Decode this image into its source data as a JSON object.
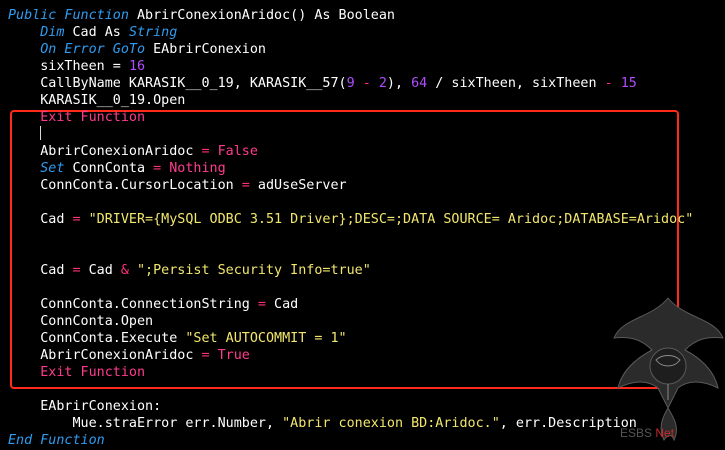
{
  "code": {
    "lines": [
      {
        "t": [
          [
            "kw",
            "Public Function"
          ],
          [
            "tx",
            " AbrirConexionAridoc() As Boolean"
          ]
        ]
      },
      {
        "t": [
          [
            "tx",
            "    "
          ],
          [
            "kw",
            "Dim"
          ],
          [
            "tx",
            " Cad As "
          ],
          [
            "kw",
            "String"
          ]
        ]
      },
      {
        "t": [
          [
            "tx",
            "    "
          ],
          [
            "kw",
            "On Error GoTo"
          ],
          [
            "tx",
            " EAbrirConexion"
          ]
        ]
      },
      {
        "t": [
          [
            "tx",
            "    sixTheen = "
          ],
          [
            "num",
            "16"
          ]
        ]
      },
      {
        "t": [
          [
            "tx",
            "    CallByName KARASIK__0_19, KARASIK__57("
          ],
          [
            "num",
            "9"
          ],
          [
            "op",
            " - "
          ],
          [
            "num",
            "2"
          ],
          [
            "tx",
            "), "
          ],
          [
            "num",
            "64"
          ],
          [
            "tx",
            " / sixTheen, sixTheen "
          ],
          [
            "op",
            "-"
          ],
          [
            "tx",
            " "
          ],
          [
            "num",
            "15"
          ]
        ]
      },
      {
        "t": [
          [
            "tx",
            "    KARASIK__0_19.Open"
          ]
        ]
      },
      {
        "t": [
          [
            "tx",
            "    "
          ],
          [
            "st",
            "Exit Function"
          ]
        ]
      },
      {
        "t": []
      },
      {
        "t": [
          [
            "tx",
            "    AbrirConexionAridoc "
          ],
          [
            "op",
            "="
          ],
          [
            "tx",
            " "
          ],
          [
            "st",
            "False"
          ]
        ]
      },
      {
        "t": [
          [
            "tx",
            "    "
          ],
          [
            "kw",
            "Set"
          ],
          [
            "tx",
            " ConnConta "
          ],
          [
            "op",
            "="
          ],
          [
            "tx",
            " "
          ],
          [
            "st",
            "Nothing"
          ]
        ]
      },
      {
        "t": [
          [
            "tx",
            "    ConnConta.CursorLocation "
          ],
          [
            "op",
            "="
          ],
          [
            "tx",
            " adUseServer"
          ]
        ]
      },
      {
        "t": []
      },
      {
        "t": [
          [
            "tx",
            "    Cad "
          ],
          [
            "op",
            "="
          ],
          [
            "tx",
            " "
          ],
          [
            "str",
            "\"DRIVER={MySQL ODBC 3.51 Driver};DESC=;DATA SOURCE= Aridoc;DATABASE=Aridoc\""
          ]
        ]
      },
      {
        "t": []
      },
      {
        "t": []
      },
      {
        "t": [
          [
            "tx",
            "    Cad "
          ],
          [
            "op",
            "="
          ],
          [
            "tx",
            " Cad "
          ],
          [
            "op",
            "&"
          ],
          [
            "tx",
            " "
          ],
          [
            "str",
            "\";Persist Security Info=true\""
          ]
        ]
      },
      {
        "t": []
      },
      {
        "t": [
          [
            "tx",
            "    ConnConta.ConnectionString "
          ],
          [
            "op",
            "="
          ],
          [
            "tx",
            " Cad"
          ]
        ]
      },
      {
        "t": [
          [
            "tx",
            "    ConnConta.Open"
          ]
        ]
      },
      {
        "t": [
          [
            "tx",
            "    ConnConta.Execute "
          ],
          [
            "str",
            "\"Set AUTOCOMMIT = 1\""
          ]
        ]
      },
      {
        "t": [
          [
            "tx",
            "    AbrirConexionAridoc "
          ],
          [
            "op",
            "="
          ],
          [
            "tx",
            " "
          ],
          [
            "st",
            "True"
          ]
        ]
      },
      {
        "t": [
          [
            "tx",
            "    "
          ],
          [
            "st",
            "Exit Function"
          ]
        ]
      },
      {
        "t": []
      },
      {
        "t": [
          [
            "tx",
            "    EAbrirConexion:"
          ]
        ]
      },
      {
        "t": [
          [
            "tx",
            "        Mue.straError err.Number, "
          ],
          [
            "str",
            "\"Abrir conexion BD:Aridoc.\""
          ],
          [
            "tx",
            ", err.Description"
          ]
        ]
      },
      {
        "t": [
          [
            "kw",
            "End Function"
          ]
        ]
      }
    ]
  },
  "watermark": {
    "brand_a": "ESBS",
    "brand_b": "Net"
  },
  "colors": {
    "background": "#000000",
    "keyword": "#2f9cf0",
    "statement": "#ff3b8e",
    "number": "#b04dff",
    "string": "#f2e66e",
    "highlight_box": "#ff2a1a"
  }
}
